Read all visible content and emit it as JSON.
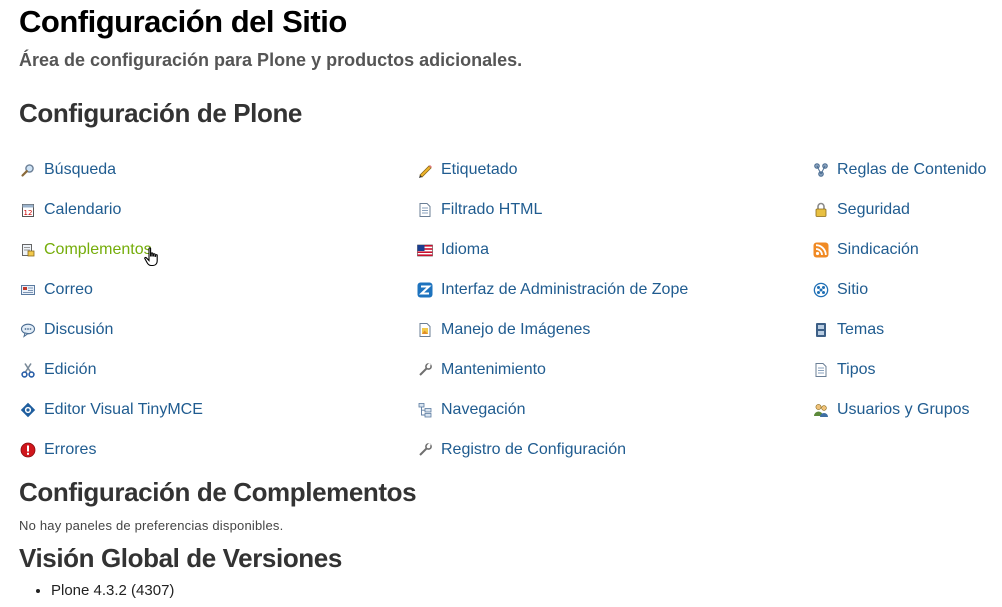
{
  "page": {
    "title": "Configuración del Sitio",
    "subtitle": "Área de configuración para Plone y productos adicionales."
  },
  "plone_config": {
    "heading": "Configuración de Plone",
    "columns": [
      [
        {
          "label": "Búsqueda",
          "icon": "magnifier-icon"
        },
        {
          "label": "Calendario",
          "icon": "calendar-icon"
        },
        {
          "label": "Complementos",
          "icon": "addons-icon"
        },
        {
          "label": "Correo",
          "icon": "mail-icon"
        },
        {
          "label": "Discusión",
          "icon": "discussion-icon"
        },
        {
          "label": "Edición",
          "icon": "scissors-icon"
        },
        {
          "label": "Editor Visual TinyMCE",
          "icon": "tinymce-icon"
        },
        {
          "label": "Errores",
          "icon": "error-icon"
        }
      ],
      [
        {
          "label": "Etiquetado",
          "icon": "pencil-icon"
        },
        {
          "label": "Filtrado HTML",
          "icon": "document-icon"
        },
        {
          "label": "Idioma",
          "icon": "flag-icon"
        },
        {
          "label": "Interfaz de Administración de Zope",
          "icon": "zope-icon"
        },
        {
          "label": "Manejo de Imágenes",
          "icon": "image-icon"
        },
        {
          "label": "Mantenimiento",
          "icon": "wrench-icon"
        },
        {
          "label": "Navegación",
          "icon": "navigation-icon"
        },
        {
          "label": "Registro de Configuración",
          "icon": "wrench-icon"
        }
      ],
      [
        {
          "label": "Reglas de Contenido",
          "icon": "rules-icon"
        },
        {
          "label": "Seguridad",
          "icon": "lock-icon"
        },
        {
          "label": "Sindicación",
          "icon": "rss-icon"
        },
        {
          "label": "Sitio",
          "icon": "site-icon"
        },
        {
          "label": "Temas",
          "icon": "theme-icon"
        },
        {
          "label": "Tipos",
          "icon": "types-icon"
        },
        {
          "label": "Usuarios y Grupos",
          "icon": "users-icon"
        }
      ]
    ]
  },
  "addons_config": {
    "heading": "Configuración de Complementos",
    "empty_text": "No hay paneles de preferencias disponibles."
  },
  "versions": {
    "heading": "Visión Global de Versiones",
    "items": [
      "Plone 4.3.2 (4307)"
    ]
  },
  "colors": {
    "link": "#205c90",
    "link_hover": "#75ad0a",
    "heading": "#333333",
    "subtitle": "#555555"
  }
}
